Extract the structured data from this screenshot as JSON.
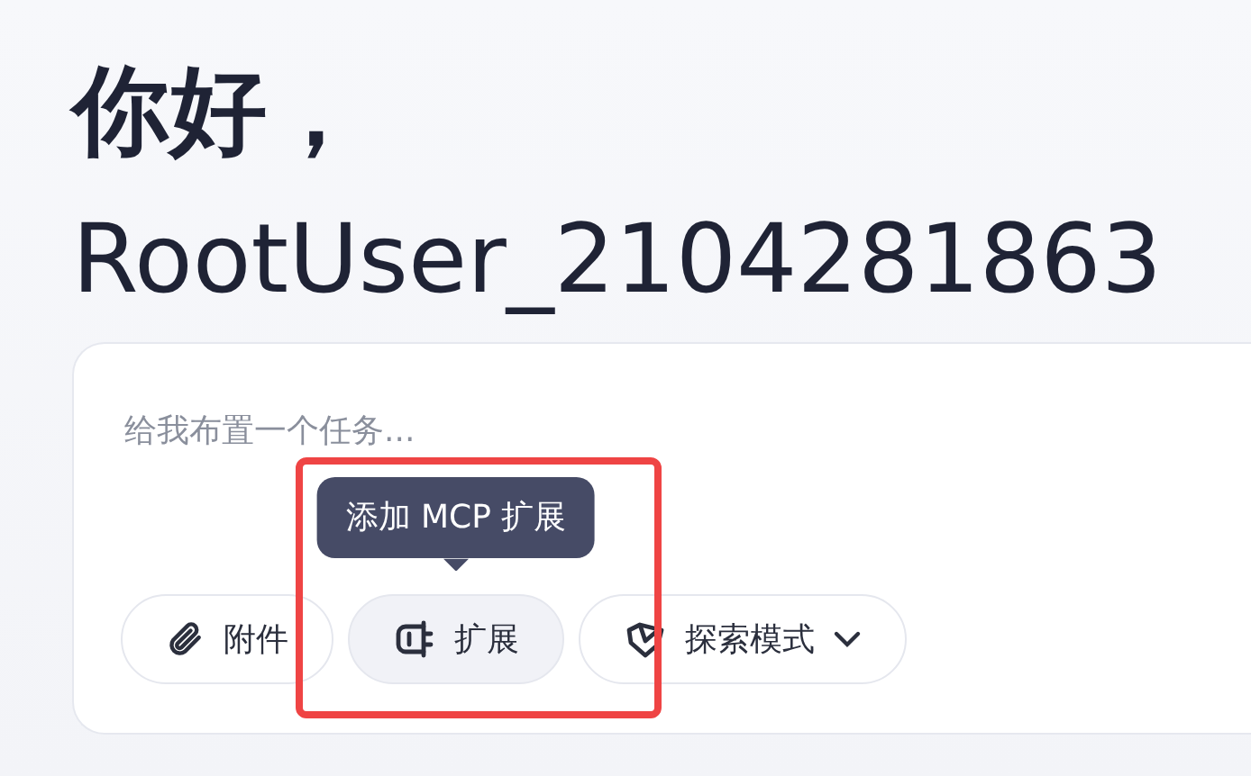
{
  "greeting": {
    "line_1": "你好，",
    "line_2": "RootUser_2104281863"
  },
  "composer": {
    "placeholder": "给我布置一个任务...",
    "tooltip": "添加 MCP 扩展",
    "buttons": [
      {
        "kind": "attach",
        "label": "附件",
        "selected": false
      },
      {
        "kind": "extension",
        "label": "扩展",
        "selected": true
      },
      {
        "kind": "mode",
        "label": "探索模式",
        "selected": false
      }
    ]
  }
}
